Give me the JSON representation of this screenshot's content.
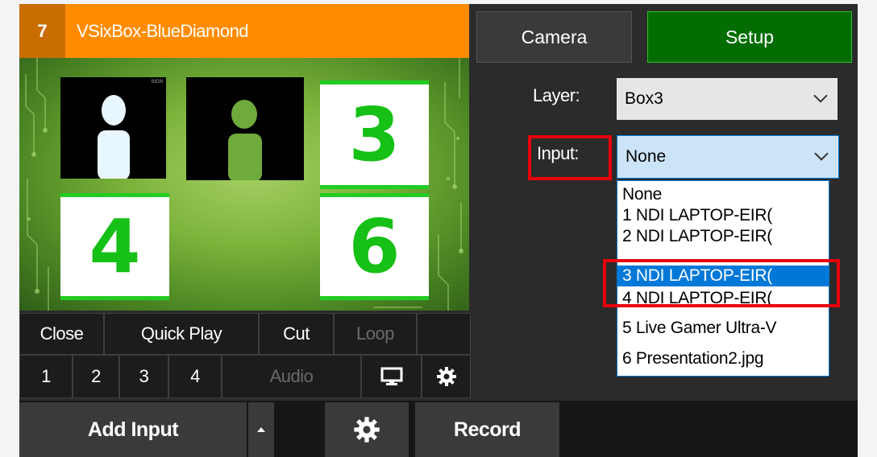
{
  "input_tile": {
    "number": "7",
    "title": "VSixBox-BlueDiamond",
    "box_numbers": [
      "3",
      "4",
      "6"
    ],
    "thumb_caption": "SIGN"
  },
  "controls": {
    "row1": [
      "Close",
      "Quick Play",
      "Cut",
      "Loop"
    ],
    "row2": [
      "1",
      "2",
      "3",
      "4"
    ],
    "audio": "Audio",
    "monitor_icon": "monitor-icon",
    "settings_icon": "gear-icon"
  },
  "bottom_bar": {
    "add_input": "Add Input",
    "record": "Record"
  },
  "right_panel": {
    "camera": "Camera",
    "setup": "Setup",
    "layer_label": "Layer:",
    "layer_value": "Box3",
    "input_label": "Input:",
    "input_value": "None",
    "input_options": [
      "None",
      "1 NDI LAPTOP-EIR(",
      "2 NDI LAPTOP-EIR(",
      "3 NDI LAPTOP-EIR(",
      "4 NDI LAPTOP-EIR(",
      "5 Live Gamer Ultra-V",
      "6 Presentation2.jpg"
    ],
    "selected_option": "3 NDI LAPTOP-EIR("
  },
  "colors": {
    "title_bar": "#ff8c00",
    "setup_green": "#036d03",
    "selection_blue": "#0078d7",
    "highlight_red": "#e8000d",
    "number_green": "#16c016"
  }
}
